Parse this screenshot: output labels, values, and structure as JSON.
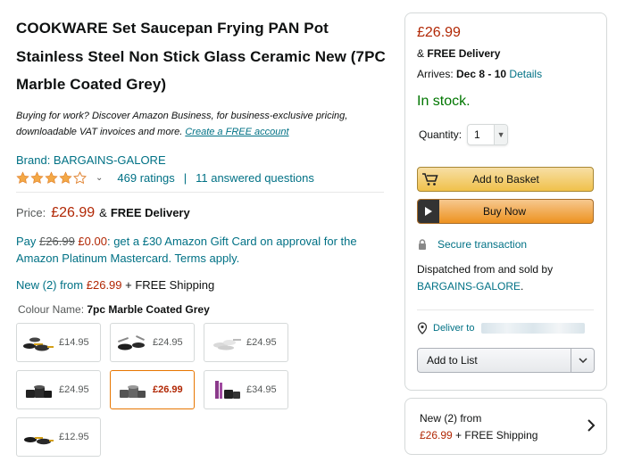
{
  "product": {
    "title": "COOKWARE Set Saucepan Frying PAN Pot Stainless Steel Non Stick Glass Ceramic New (7PC Marble Coated Grey)",
    "business_text": "Buying for work? Discover Amazon Business, for business-exclusive pricing, downloadable VAT invoices and more.",
    "business_link": "Create a FREE account",
    "brand": "Brand: BARGAINS-GALORE",
    "rating_value": 4,
    "ratings_count": "469 ratings",
    "separator": "|",
    "answered_questions": "11 answered questions",
    "price_label": "Price:",
    "price": "£26.99",
    "price_amp": "&",
    "price_delivery": "FREE Delivery",
    "promo_pay": "Pay",
    "promo_old": "£26.99",
    "promo_new": "£0.00",
    "promo_text": ": get a £30 Amazon Gift Card on approval for the Amazon Platinum Mastercard. Terms apply.",
    "new_link": "New (2) from",
    "new_price": "£26.99",
    "new_shipping": "+ FREE Shipping",
    "colour_label": "Colour Name:",
    "colour_value": "7pc Marble Coated Grey",
    "swatches": [
      {
        "price": "£14.95",
        "selected": false
      },
      {
        "price": "£24.95",
        "selected": false
      },
      {
        "price": "£24.95",
        "selected": false
      },
      {
        "price": "£24.95",
        "selected": false
      },
      {
        "price": "£26.99",
        "selected": true
      },
      {
        "price": "£34.95",
        "selected": false
      },
      {
        "price": "£12.95",
        "selected": false
      }
    ]
  },
  "buybox": {
    "price": "£26.99",
    "delivery_amp": "&",
    "delivery": "FREE Delivery",
    "arrives_label": "Arrives:",
    "arrives_dates": "Dec 8 - 10",
    "details_link": "Details",
    "stock": "In stock.",
    "quantity_label": "Quantity:",
    "quantity_value": "1",
    "add_to_basket": "Add to Basket",
    "buy_now": "Buy Now",
    "secure": "Secure transaction",
    "dispatched_text": "Dispatched from and sold by",
    "seller": "BARGAINS-GALORE",
    "seller_suffix": ".",
    "deliver_to": "Deliver to",
    "add_to_list": "Add to List"
  },
  "others": {
    "line1": "New (2) from",
    "price": "£26.99",
    "shipping": "+ FREE Shipping"
  },
  "colors": {
    "link": "#007185",
    "price_red": "#b12704",
    "stock_green": "#007600",
    "star_orange": "#de7921",
    "basket_yellow": "#f0c14b",
    "buy_orange": "#ed9220"
  }
}
